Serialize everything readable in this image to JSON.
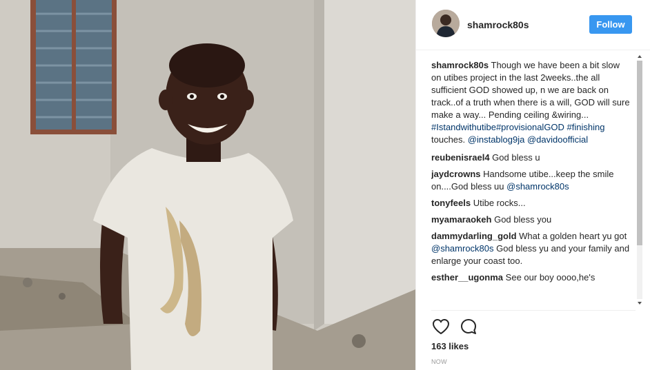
{
  "post": {
    "username": "shamrock80s",
    "follow_label": "Follow",
    "likes": "163 likes",
    "time": "NOW"
  },
  "caption": {
    "user": "shamrock80s",
    "text": "Though we have been a bit slow on utibes project in the last 2weeks..the all sufficient GOD showed up, n we are back on track..of a truth when there is a will, GOD will sure make a way... Pending ceiling &wiring...",
    "tags": "#Istandwithutibe#provisionalGOD #finishing",
    "after_tags": " touches. ",
    "mention1": "@instablog9ja",
    "mention2": "@davidoofficial"
  },
  "comments": [
    {
      "user": "reubenisrael4",
      "text": "God bless u",
      "mention": ""
    },
    {
      "user": "jaydcrowns",
      "text": "Handsome utibe...keep the smile on....God bless uu ",
      "mention": "@shamrock80s"
    },
    {
      "user": "tonyfeels",
      "text": "Utibe rocks...",
      "mention": ""
    },
    {
      "user": "myamaraokeh",
      "text": "God bless you",
      "mention": ""
    },
    {
      "user": "dammydarling_gold",
      "text": "What a golden heart yu got ",
      "mention": "@shamrock80s",
      "tail": " God bless yu and your family and enlarge your coast too."
    },
    {
      "user": "esther__ugonma",
      "text": "See our boy oooo,he's",
      "mention": ""
    }
  ],
  "icons": {
    "like": "heart-icon",
    "comment": "comment-icon"
  },
  "colors": {
    "follow_button": "#3897f0",
    "link": "#003569",
    "time": "#999999"
  }
}
